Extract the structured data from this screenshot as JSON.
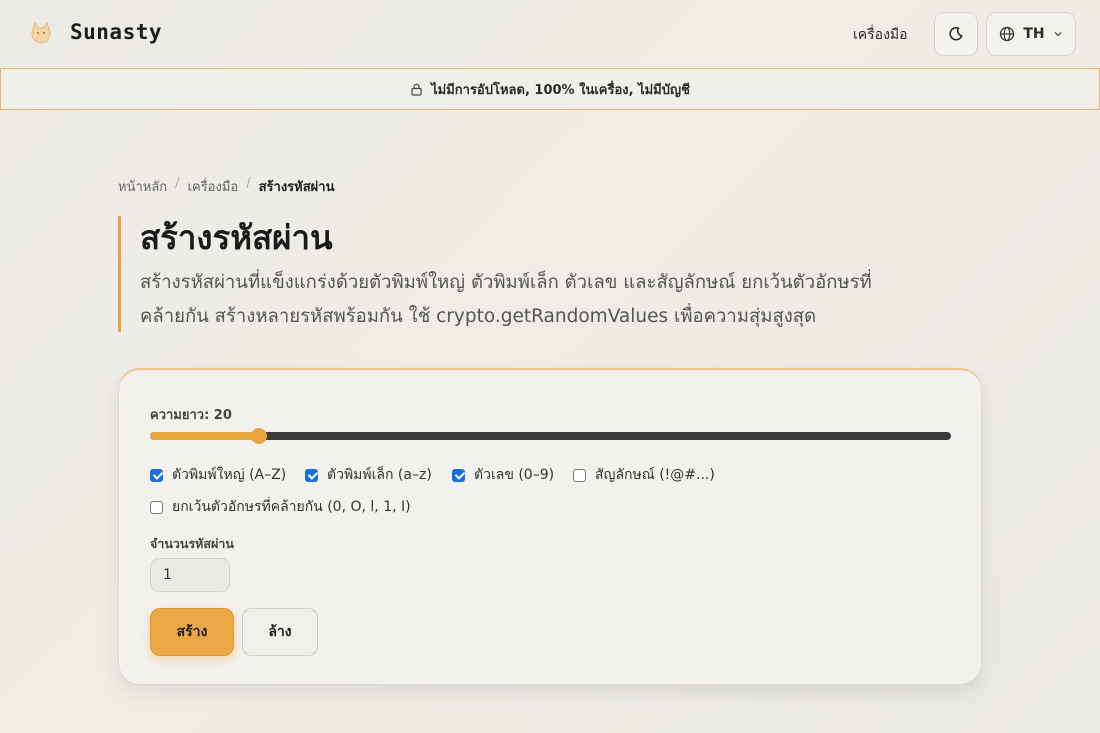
{
  "header": {
    "brand": "Sunasty",
    "nav_tools": "เครื่องมือ",
    "lang_code": "TH"
  },
  "privacy_notice": "ไม่มีการอัปโหลด, 100% ในเครื่อง, ไม่มีบัญชี",
  "breadcrumb": {
    "home": "หน้าหลัก",
    "tools": "เครื่องมือ",
    "current": "สร้างรหัสผ่าน",
    "separator": "/"
  },
  "page": {
    "title": "สร้างรหัสผ่าน",
    "description_line1": "สร้างรหัสผ่านที่แข็งแกร่งด้วยตัวพิมพ์ใหญ่ ตัวพิมพ์เล็ก ตัวเลข และสัญลักษณ์ ยกเว้นตัวอักษรที่",
    "description_line2": "คล้ายกัน สร้างหลายรหัสพร้อมกัน ใช้ crypto.getRandomValues เพื่อความสุ่มสูงสุด"
  },
  "generator": {
    "length_label": "ความยาว: 20",
    "length_fraction": 0.136,
    "options": [
      {
        "label": "ตัวพิมพ์ใหญ่ (A–Z)",
        "checked": true
      },
      {
        "label": "ตัวพิมพ์เล็ก (a–z)",
        "checked": true
      },
      {
        "label": "ตัวเลข (0–9)",
        "checked": true
      },
      {
        "label": "สัญลักษณ์ (!@#...)",
        "checked": false
      },
      {
        "label": "ยกเว้นตัวอักษรที่คล้ายกัน (0, O, l, 1, I)",
        "checked": false
      }
    ],
    "count_label": "จำนวนรหัสผ่าน",
    "count_value": "1",
    "generate_label": "สร้าง",
    "clear_label": "ล้าง"
  },
  "colors": {
    "accent": "#e8a33f",
    "checkbox": "#1a6fde"
  },
  "icons": {
    "logo": "cat-logo-icon",
    "theme": "moon-icon",
    "language": "globe-icon",
    "dropdown": "chevron-down-icon",
    "privacy": "lock-icon"
  }
}
